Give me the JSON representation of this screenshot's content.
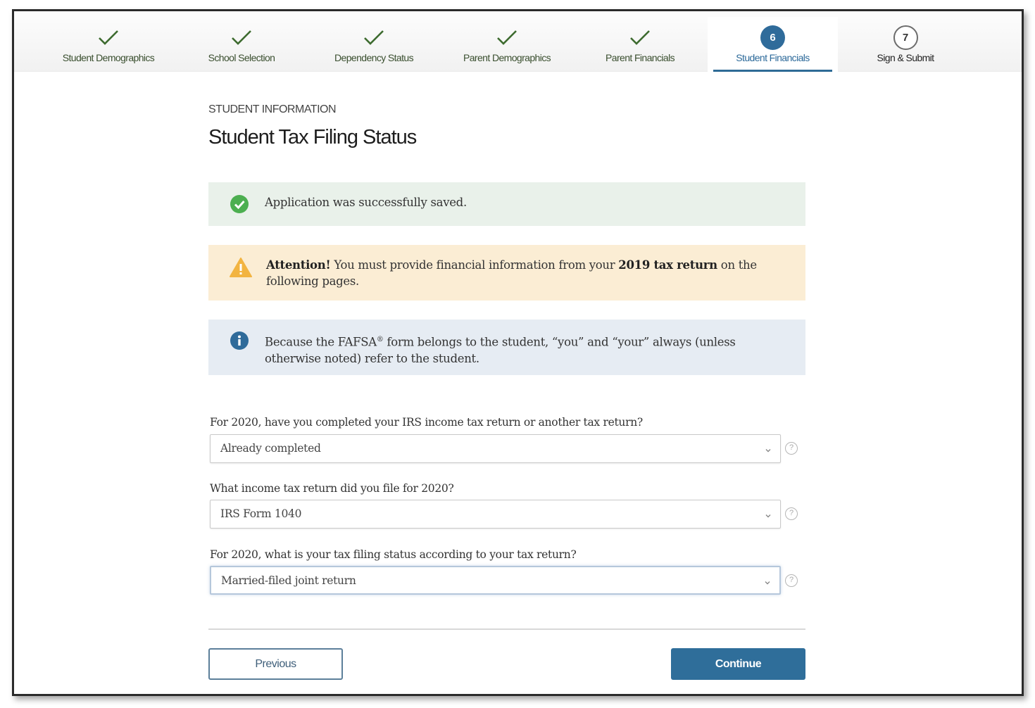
{
  "stepper": {
    "steps": [
      {
        "label": "Student Demographics",
        "state": "complete"
      },
      {
        "label": "School Selection",
        "state": "complete"
      },
      {
        "label": "Dependency Status",
        "state": "complete"
      },
      {
        "label": "Parent Demographics",
        "state": "complete"
      },
      {
        "label": "Parent Financials",
        "state": "complete"
      },
      {
        "label": "Student Financials",
        "state": "active",
        "number": "6"
      },
      {
        "label": "Sign & Submit",
        "state": "pending",
        "number": "7"
      }
    ]
  },
  "page": {
    "section": "STUDENT INFORMATION",
    "title": "Student Tax Filing Status"
  },
  "alerts": {
    "success": {
      "icon": "check-circle-icon",
      "text": "Application was successfully saved."
    },
    "warning": {
      "icon": "warning-triangle-icon",
      "lead": "Attention!",
      "text_before": " You must provide financial information from your ",
      "bold": "2019 tax return",
      "text_after": " on the following pages."
    },
    "info": {
      "icon": "info-circle-icon",
      "text_before": "Because the FAFSA",
      "sup": "®",
      "text_after": " form belongs to the student, “you” and “your” always (unless otherwise noted) refer to the student."
    }
  },
  "form": {
    "fields": [
      {
        "label": "For 2020, have you completed your IRS income tax return or another tax return?",
        "value": "Already completed",
        "help": "?"
      },
      {
        "label": "What income tax return did you file for 2020?",
        "value": "IRS Form 1040",
        "help": "?"
      },
      {
        "label": "For 2020, what is your tax filing status according to your tax return?",
        "value": "Married-filed joint return",
        "help": "?"
      }
    ]
  },
  "buttons": {
    "previous": "Previous",
    "continue": "Continue"
  },
  "colors": {
    "primary": "#2f6e9a",
    "complete_check": "#3d6b2f",
    "success_bg": "#e9f1ea",
    "success_icon": "#4caf50",
    "warning_bg": "#fbedd4",
    "warning_icon": "#f2b441",
    "info_bg": "#e6ecf3",
    "info_icon": "#2f6b9a"
  }
}
